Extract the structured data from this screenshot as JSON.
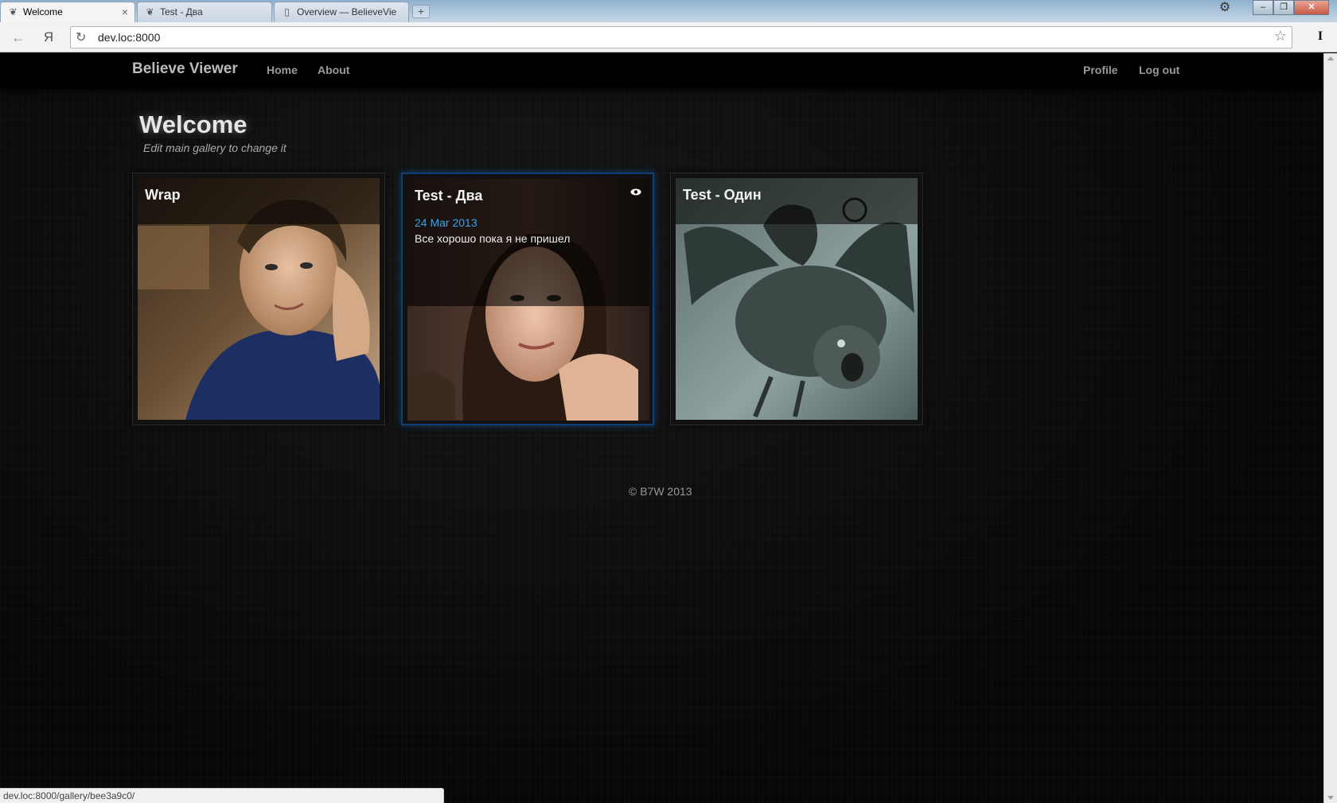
{
  "browser": {
    "tabs": [
      {
        "label": "Welcome",
        "active": true
      },
      {
        "label": "Test - Два",
        "active": false
      },
      {
        "label": "Overview — BelieveVie",
        "active": false
      }
    ],
    "new_tab": "+",
    "address": "dev.loc:8000",
    "status_url": "dev.loc:8000/gallery/bee3a9c0/",
    "yandex_button": "Я",
    "extension_label": "I"
  },
  "navbar": {
    "brand": "Believe Viewer",
    "links_left": [
      "Home",
      "About"
    ],
    "links_right": [
      "Profile",
      "Log out"
    ]
  },
  "hero": {
    "title": "Welcome",
    "subtitle": "Edit main gallery to change it"
  },
  "galleries": [
    {
      "title": "Wrap",
      "image": "portrait-man-blue-shirt"
    },
    {
      "title": "Test - Два",
      "date": "24 Мar 2013",
      "description": "Все хорошо пока я не пришел",
      "image": "portrait-woman",
      "selected": true,
      "icon": "eye-icon"
    },
    {
      "title": "Test - Один",
      "image": "flying-creature-illustration"
    }
  ],
  "footer": {
    "copyright": "© B7W 2013"
  },
  "colors": {
    "accent_blue": "#3fa0e8",
    "selection_border": "#0d3f74",
    "background": "#070707"
  }
}
